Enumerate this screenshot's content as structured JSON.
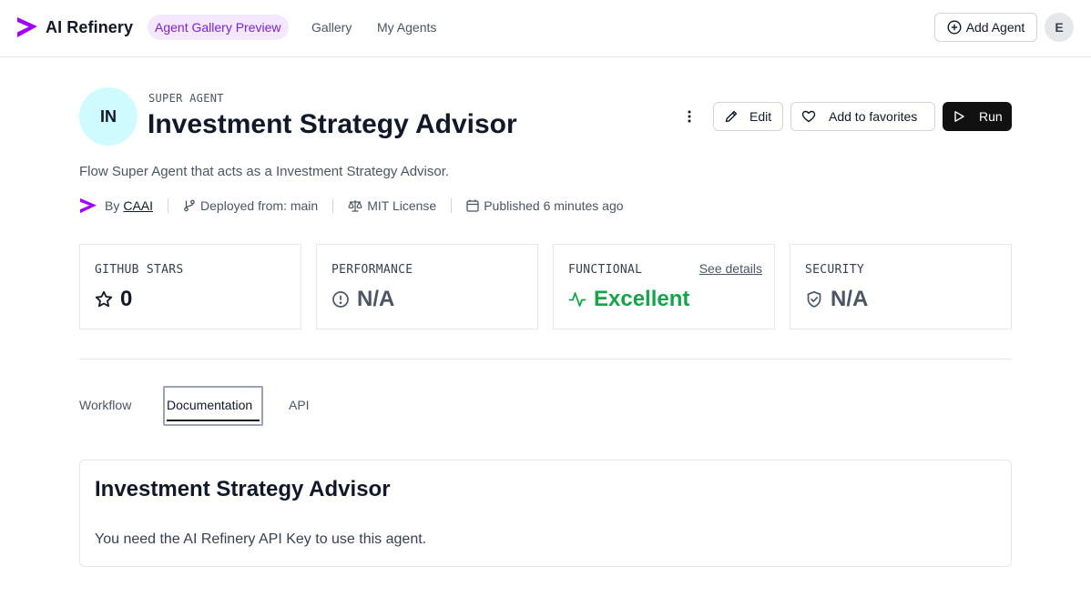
{
  "brand": {
    "name": "AI Refinery",
    "accent": "#a100ff"
  },
  "nav": {
    "active": "Agent Gallery Preview",
    "links": [
      "Gallery",
      "My Agents"
    ],
    "add_agent": "Add Agent",
    "user_initial": "E"
  },
  "agent": {
    "initials": "IN",
    "kind": "SUPER AGENT",
    "title": "Investment Strategy Advisor",
    "description": "Flow Super Agent that acts as a Investment Strategy Advisor.",
    "actions": {
      "edit": "Edit",
      "favorite": "Add to favorites",
      "run": "Run"
    },
    "meta": {
      "by_label": "By",
      "author": "CAAI",
      "deployed": "Deployed from: main",
      "license": "MIT License",
      "published": "Published 6 minutes ago"
    }
  },
  "stats": [
    {
      "label": "GITHUB STARS",
      "value": "0",
      "icon": "star-icon"
    },
    {
      "label": "PERFORMANCE",
      "value": "N/A",
      "icon": "alert-circle-icon"
    },
    {
      "label": "FUNCTIONAL",
      "value": "Excellent",
      "icon": "activity-icon",
      "link": "See details",
      "color": "#16a34a"
    },
    {
      "label": "SECURITY",
      "value": "N/A",
      "icon": "shield-check-icon"
    }
  ],
  "tabs": {
    "items": [
      "Workflow",
      "Documentation",
      "API"
    ],
    "active": "Documentation"
  },
  "documentation": {
    "title": "Investment Strategy Advisor",
    "body": "You need the AI Refinery API Key to use this agent."
  }
}
